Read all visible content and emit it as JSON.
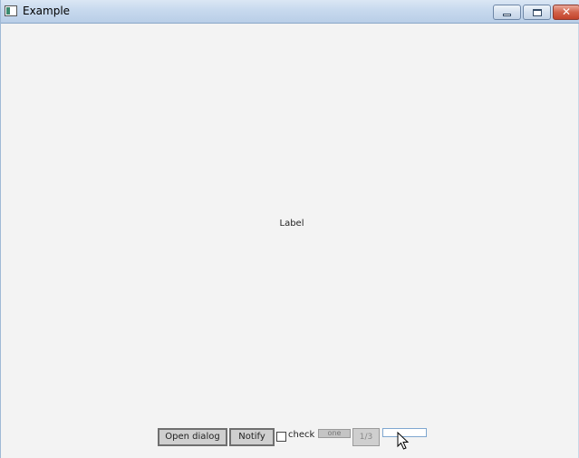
{
  "window": {
    "title": "Example",
    "icons": {
      "app": "app-window-icon",
      "minimize": "minimize-icon",
      "maximize": "maximize-icon",
      "close": "close-icon"
    },
    "close_glyph": "✕"
  },
  "main": {
    "label": "Label"
  },
  "toolbar": {
    "open_dialog_label": "Open dialog",
    "notify_label": "Notify",
    "check_label": "check",
    "check_checked": false,
    "combo_value": "one",
    "spinner_value": "1/3",
    "text_field_value": ""
  }
}
